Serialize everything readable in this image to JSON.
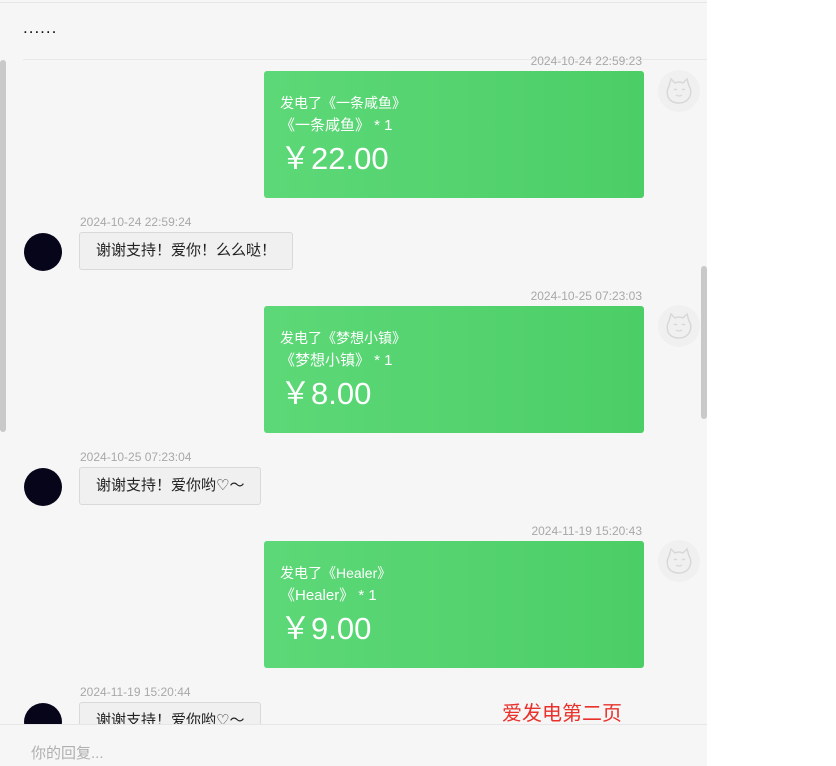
{
  "header": {
    "ellipsis": "......"
  },
  "messages": [
    {
      "timestamp": "2024-10-24 22:59:23",
      "line1": "发电了《一条咸鱼》",
      "line2": "《一条咸鱼》 * 1",
      "amount": "￥22.00"
    },
    {
      "timestamp": "2024-10-25 07:23:03",
      "line1": "发电了《梦想小镇》",
      "line2": "《梦想小镇》 * 1",
      "amount": "￥8.00"
    },
    {
      "timestamp": "2024-11-19 15:20:43",
      "line1": "发电了《Healer》",
      "line2": "《Healer》 * 1",
      "amount": "￥9.00"
    }
  ],
  "replies": [
    {
      "timestamp": "2024-10-24 22:59:24",
      "text": "谢谢支持！爱你！么么哒！"
    },
    {
      "timestamp": "2024-10-25 07:23:04",
      "text": "谢谢支持！爱你哟♡～"
    },
    {
      "timestamp": "2024-11-19 15:20:44",
      "text": "谢谢支持！爱你哟♡～"
    }
  ],
  "composer": {
    "placeholder": "你的回复..."
  },
  "annotation": "爱发电第二页",
  "colors": {
    "card_green": "#52d46f",
    "annotation_red": "#e8312a"
  },
  "icons": {
    "sender_avatar": "cat-face-icon",
    "receiver_avatar": "dark-avatar"
  }
}
